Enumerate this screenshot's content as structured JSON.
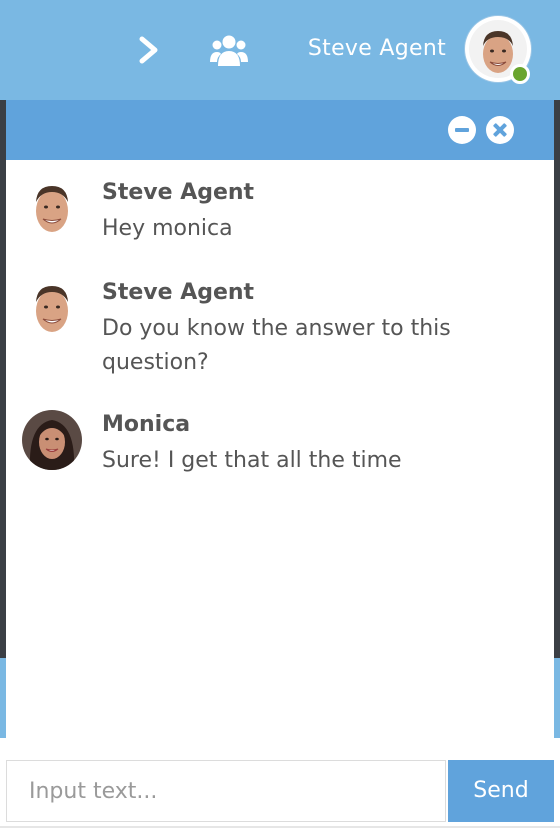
{
  "header": {
    "agent_name": "Steve Agent",
    "expand_icon": "chevron-right-icon",
    "group_icon": "users-icon",
    "status": "online",
    "status_color": "#6aa52e",
    "bar_color": "#7ab8e3"
  },
  "chat_panel": {
    "header_color": "#60a3dc",
    "controls": [
      "minimize-icon",
      "close-icon"
    ]
  },
  "messages": [
    {
      "sender": "Steve Agent",
      "text": "Hey monica",
      "avatar": "steve-avatar"
    },
    {
      "sender": "Steve Agent",
      "text": "Do you know the answer to this question?",
      "avatar": "steve-avatar"
    },
    {
      "sender": "Monica",
      "text": "Sure! I get that all the time",
      "avatar": "monica-avatar"
    }
  ],
  "composer": {
    "placeholder": "Input text...",
    "value": "",
    "send_label": "Send"
  }
}
